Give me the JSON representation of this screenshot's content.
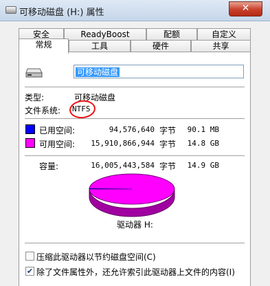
{
  "window": {
    "title": "可移动磁盘 (H:) 属性",
    "close_glyph": "✕",
    "title_icon": "drive-icon"
  },
  "tabs_row1": [
    "安全",
    "ReadyBoost",
    "配额",
    "自定义"
  ],
  "tabs_row2": [
    "常规",
    "工具",
    "硬件",
    "共享"
  ],
  "active_tab": "常规",
  "drive": {
    "name": "可移动磁盘",
    "icon": "removable-drive-icon"
  },
  "info": {
    "type_label": "类型:",
    "type_value": "可移动磁盘",
    "fs_label": "文件系统:",
    "fs_value": "NTFS"
  },
  "space": {
    "used": {
      "label": "已用空间:",
      "bytes": "94,576,640",
      "unit": "字节",
      "size": "90.1 MB",
      "color": "#0000ff"
    },
    "free": {
      "label": "可用空间:",
      "bytes": "15,910,866,944",
      "unit": "字节",
      "size": "14.8 GB",
      "color": "#ff00ff"
    },
    "capacity": {
      "label": "容量:",
      "bytes": "16,005,443,584",
      "unit": "字节",
      "size": "14.9 GB"
    }
  },
  "pie": {
    "used_fraction": 0.0059,
    "used_color": "#0000ff",
    "free_color": "#ff00ff"
  },
  "drive_label": "驱动器 H:",
  "options": {
    "compress": {
      "label": "压缩此驱动器以节约磁盘空间(C)",
      "checked": false
    },
    "index": {
      "label": "除了文件属性外，还允许索引此驱动器上文件的内容(I)",
      "checked": true
    }
  }
}
